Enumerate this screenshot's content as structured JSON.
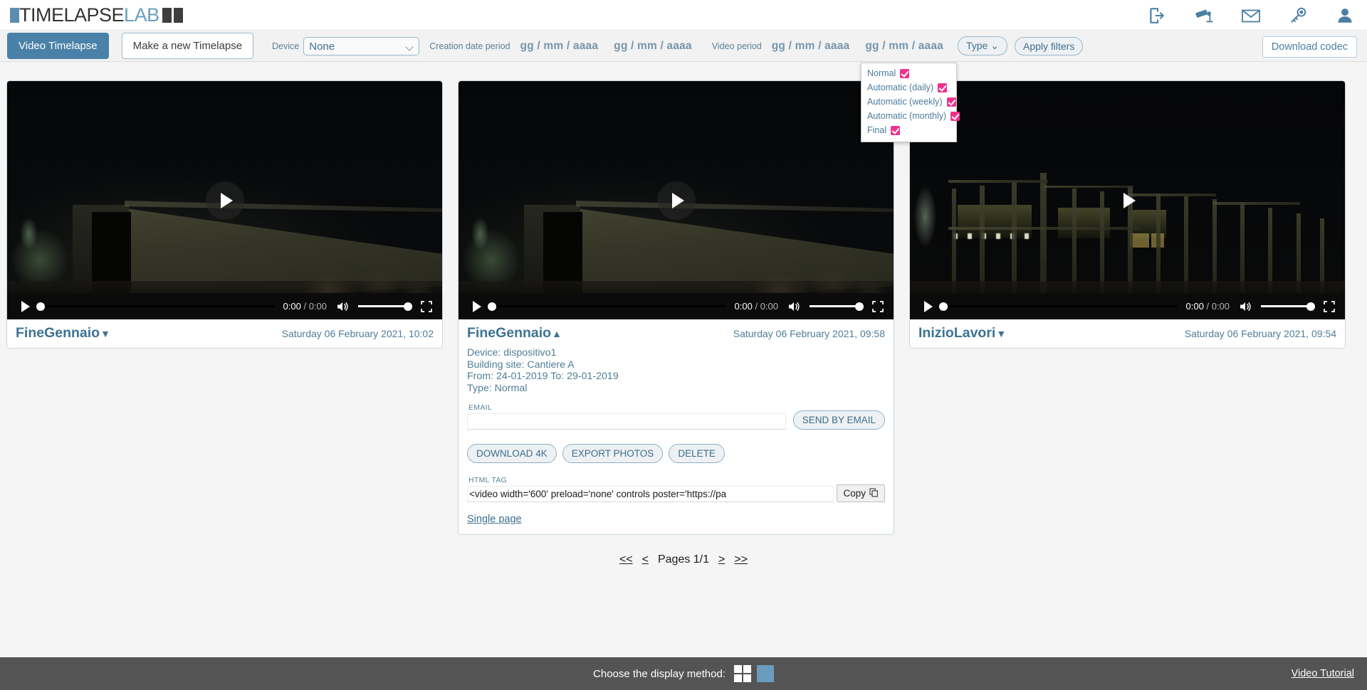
{
  "brand": {
    "name_dark": "TIMELAPSE",
    "name_light": "LAB"
  },
  "header": {
    "icons": [
      {
        "name": "logout-icon",
        "title": "Logout"
      },
      {
        "name": "camera-icon",
        "title": "Cameras"
      },
      {
        "name": "mail-icon",
        "title": "Messages"
      },
      {
        "name": "key-icon",
        "title": "Credentials"
      },
      {
        "name": "user-icon",
        "title": "Account"
      }
    ]
  },
  "toolbar": {
    "tab_video_timelapse": "Video Timelapse",
    "tab_make_new": "Make a new Timelapse",
    "device_label": "Device",
    "device_value": "None",
    "device_options": [
      "None"
    ],
    "creation_label": "Creation date period",
    "creation_from": "gg / mm / aaaa",
    "creation_to": "gg / mm / aaaa",
    "video_label": "Video period",
    "video_from": "gg / mm / aaaa",
    "video_to": "gg / mm / aaaa",
    "type_button": "Type",
    "apply_filters": "Apply filters",
    "download_codec": "Download codec"
  },
  "type_dropdown": {
    "options": [
      {
        "label": "Normal",
        "checked": true
      },
      {
        "label": "Automatic (daily)",
        "checked": true
      },
      {
        "label": "Automatic (weekly)",
        "checked": true
      },
      {
        "label": "Automatic (monthly)",
        "checked": true
      },
      {
        "label": "Final",
        "checked": true
      }
    ],
    "check_color": "#f0328c"
  },
  "cards": [
    {
      "title": "FineGennaio",
      "arrow": "▼",
      "date": "Saturday 06 February 2021, 10:02",
      "expanded": false,
      "player": {
        "time": "0:00",
        "separator": "/",
        "duration": "0:00"
      }
    },
    {
      "title": "FineGennaio",
      "arrow": "▲",
      "date": "Saturday 06 February 2021, 09:58",
      "expanded": true,
      "player": {
        "time": "0:00",
        "separator": "/",
        "duration": "0:00"
      },
      "details": {
        "device": "Device: dispositivo1",
        "building_site": "Building site: Cantiere A",
        "period": "From: 24-01-2019 To: 29-01-2019",
        "type": "Type: Normal"
      },
      "email": {
        "legend": "EMAIL",
        "value": "",
        "send_button": "SEND BY EMAIL"
      },
      "actions": [
        "DOWNLOAD 4K",
        "EXPORT PHOTOS",
        "DELETE"
      ],
      "html_tag": {
        "legend": "HTML TAG",
        "value": "<video width='600' preload='none' controls poster='https://pa",
        "copy_button": "Copy"
      },
      "single_page": "Single page"
    },
    {
      "title": "InizioLavori",
      "arrow": "▼",
      "date": "Saturday 06 February 2021, 09:54",
      "expanded": false,
      "player": {
        "time": "0:00",
        "separator": "/",
        "duration": "0:00"
      }
    }
  ],
  "pagination": {
    "first": "<<",
    "prev": "<",
    "pages": "Pages 1/1",
    "next": ">",
    "last": ">>"
  },
  "footer": {
    "display_method_label": "Choose the display method:",
    "video_tutorial": "Video Tutorial"
  },
  "colors": {
    "accent_blue": "#4a81a8",
    "link_blue": "#3d7394",
    "checkbox_pink": "#f0328c",
    "footer_gray": "#545454",
    "display_single_blue": "#6b9bbd"
  }
}
